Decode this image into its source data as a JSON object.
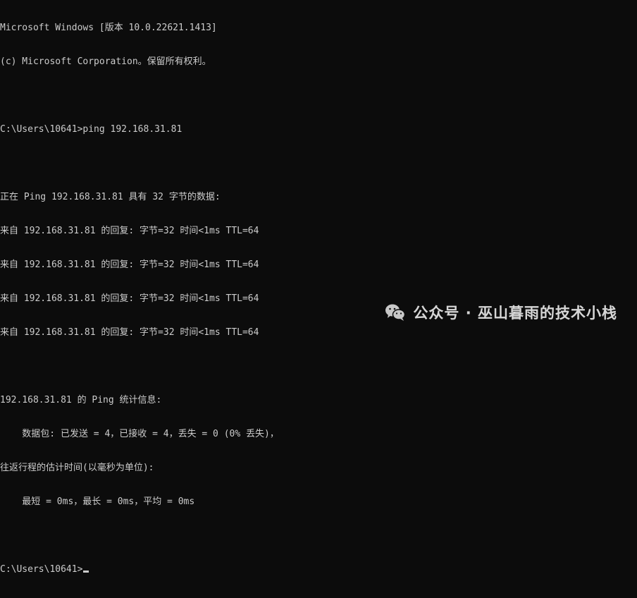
{
  "console": {
    "lines": [
      "Microsoft Windows [版本 10.0.22621.1413]",
      "(c) Microsoft Corporation。保留所有权利。",
      "",
      "C:\\Users\\10641>ping 192.168.31.81",
      "",
      "正在 Ping 192.168.31.81 具有 32 字节的数据:",
      "来自 192.168.31.81 的回复: 字节=32 时间<1ms TTL=64",
      "来自 192.168.31.81 的回复: 字节=32 时间<1ms TTL=64",
      "来自 192.168.31.81 的回复: 字节=32 时间<1ms TTL=64",
      "来自 192.168.31.81 的回复: 字节=32 时间<1ms TTL=64",
      "",
      "192.168.31.81 的 Ping 统计信息:",
      "    数据包: 已发送 = 4，已接收 = 4，丢失 = 0 (0% 丢失)，",
      "往返行程的估计时间(以毫秒为单位):",
      "    最短 = 0ms，最长 = 0ms，平均 = 0ms",
      ""
    ],
    "prompt": "C:\\Users\\10641>"
  },
  "watermark": {
    "text": "公众号 · 巫山暮雨的技术小栈",
    "icon": "wechat-icon"
  },
  "colors": {
    "background": "#0c0c0c",
    "text": "#cccccc"
  }
}
